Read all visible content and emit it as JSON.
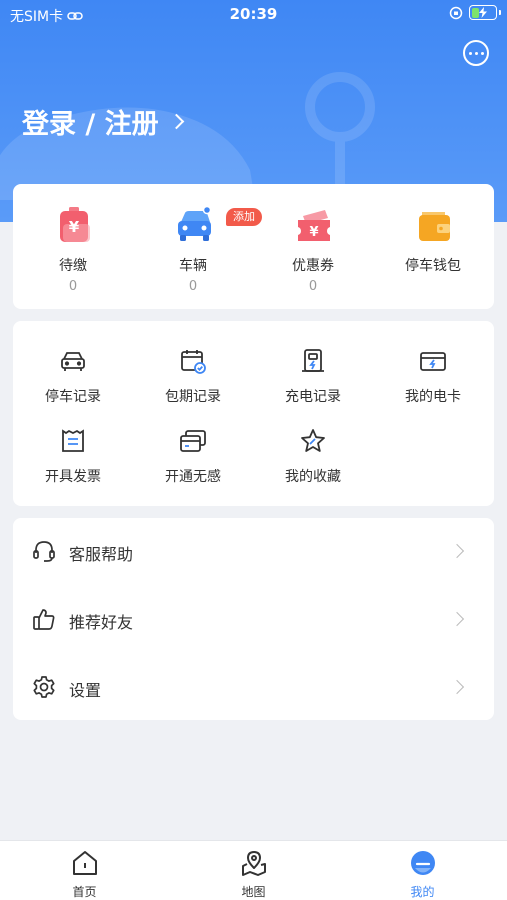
{
  "status_bar": {
    "carrier": "无SIM卡",
    "time": "20:39"
  },
  "header": {
    "login_label": "登录 / 注册"
  },
  "summary": {
    "items": [
      {
        "label": "待缴",
        "count": "0",
        "icon": "payment-due-icon"
      },
      {
        "label": "车辆",
        "count": "0",
        "icon": "vehicle-icon",
        "badge": "添加"
      },
      {
        "label": "优惠券",
        "count": "0",
        "icon": "coupon-icon"
      },
      {
        "label": "停车钱包",
        "count": "",
        "icon": "wallet-icon"
      }
    ]
  },
  "services": {
    "items": [
      {
        "label": "停车记录",
        "icon": "car-icon"
      },
      {
        "label": "包期记录",
        "icon": "calendar-check-icon"
      },
      {
        "label": "充电记录",
        "icon": "charger-icon"
      },
      {
        "label": "我的电卡",
        "icon": "card-icon"
      },
      {
        "label": "开具发票",
        "icon": "invoice-icon"
      },
      {
        "label": "开通无感",
        "icon": "seamless-pay-icon"
      },
      {
        "label": "我的收藏",
        "icon": "star-icon"
      }
    ]
  },
  "menu": {
    "items": [
      {
        "label": "客服帮助",
        "icon": "headset-icon"
      },
      {
        "label": "推荐好友",
        "icon": "thumbs-up-icon"
      },
      {
        "label": "设置",
        "icon": "gear-icon"
      }
    ]
  },
  "tabbar": {
    "tabs": [
      {
        "label": "首页",
        "icon": "home-icon"
      },
      {
        "label": "地图",
        "icon": "map-icon"
      },
      {
        "label": "我的",
        "icon": "profile-icon",
        "active": true
      }
    ]
  },
  "colors": {
    "primary": "#3f87f4",
    "badge": "#f25a4a",
    "background": "#eff1f5"
  }
}
